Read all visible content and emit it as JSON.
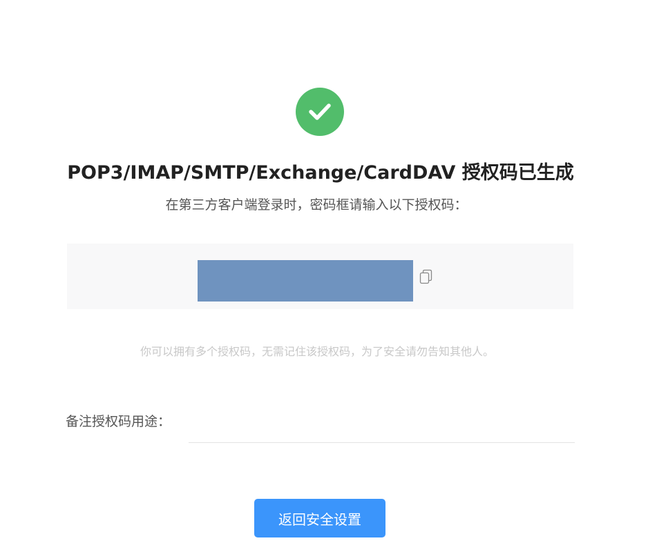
{
  "status": {
    "icon": "check-circle-icon",
    "color": "#52bd6b"
  },
  "title": "POP3/IMAP/SMTP/Exchange/CardDAV 授权码已生成",
  "subtitle": "在第三方客户端登录时，密码框请输入以下授权码：",
  "auth_code": {
    "masked": true,
    "mask_color": "#6f93bf",
    "copy_icon": "copy-icon"
  },
  "tip": "你可以拥有多个授权码，无需记住该授权码，为了安全请勿告知其他人。",
  "remark": {
    "label": "备注授权码用途：",
    "value": "",
    "placeholder": ""
  },
  "actions": {
    "back_label": "返回安全设置",
    "accent": "#3b95fb"
  }
}
